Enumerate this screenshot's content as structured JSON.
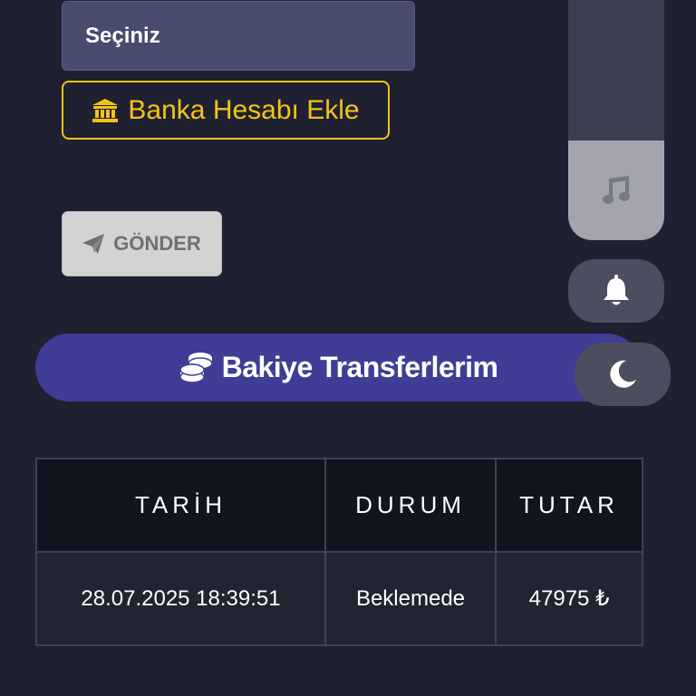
{
  "form": {
    "select_value": "Seçiniz",
    "bank_button_label": "Banka Hesabı Ekle",
    "send_button_label": "GÖNDER"
  },
  "banner": {
    "title": "Bakiye Transferlerim"
  },
  "side_controls": {
    "icons": [
      "music-icon",
      "bell-icon",
      "moon-icon"
    ]
  },
  "table": {
    "headers": [
      "TARİH",
      "DURUM",
      "TUTAR"
    ],
    "rows": [
      [
        "28.07.2025 18:39:51",
        "Beklemede",
        "47975 ₺"
      ]
    ]
  },
  "colors": {
    "background": "#1f2130",
    "accent_yellow": "#f5c318",
    "banner_purple": "#3f3d96",
    "select_bg": "#484b6e"
  }
}
